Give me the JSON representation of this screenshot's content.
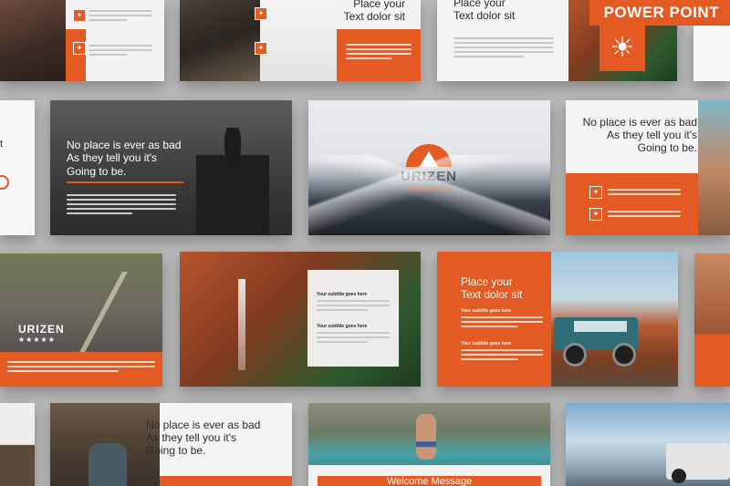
{
  "badge": {
    "label": "POWER POINT"
  },
  "brand": {
    "name": "URIZEN",
    "stars": "★★★★★"
  },
  "slides": {
    "r1s2": {
      "title_l1": "Place your",
      "title_l2": "Text dolor sit"
    },
    "r1s3": {
      "title_l1": "Place your",
      "title_l2": "Text dolor sit"
    },
    "r2s2": {
      "title_l1": "No place is ever as bad",
      "title_l2": "As they tell you it's",
      "title_l3": "Going to be."
    },
    "r2s4": {
      "title_l1": "No place is ever as bad",
      "title_l2": "As they tell you it's",
      "title_l3": "Going to be."
    },
    "r3s2": {
      "sub1": "Your subtitle goes here",
      "sub2": "Your subtitle goes here"
    },
    "r3s3": {
      "title_l1": "Place your",
      "title_l2": "Text dolor sit",
      "sub1": "Your subtitle goes here",
      "sub2": "Your subtitle goes here"
    },
    "r4s2": {
      "title_l1": "No place is ever as bad",
      "title_l2": "As they tell you it's",
      "title_l3": "Going to be."
    },
    "r4s3": {
      "footer": "Welcome Message"
    }
  },
  "icons": {
    "sun": "sun-icon",
    "mountain": "mountain-logo-icon",
    "small": "square-icon"
  }
}
